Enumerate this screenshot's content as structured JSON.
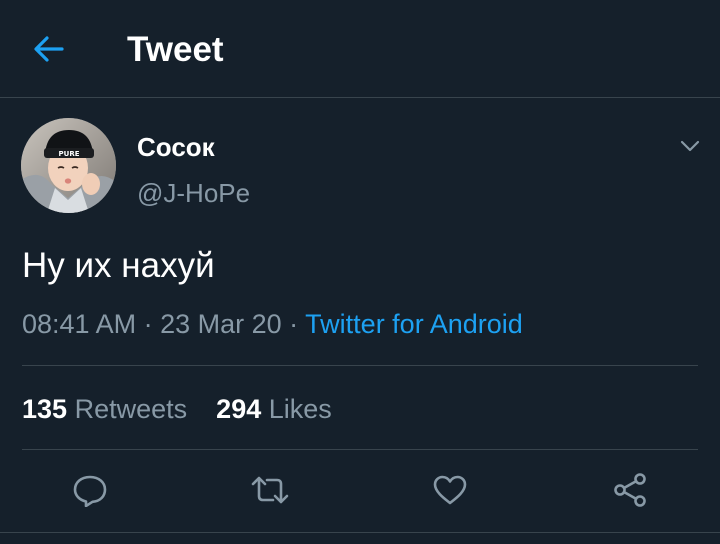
{
  "header": {
    "title": "Tweet",
    "back_icon": "arrow-left-icon"
  },
  "author": {
    "name": "Сосок",
    "handle": "@J-HoPe",
    "avatar_beanie_text": "PURE"
  },
  "tweet": {
    "text": "Ну их нахуй",
    "time": "08:41 AM",
    "date": "23 Mar 20",
    "separator": " · ",
    "source": "Twitter for Android"
  },
  "stats": {
    "retweets_count": "135",
    "retweets_label": "Retweets",
    "likes_count": "294",
    "likes_label": "Likes"
  },
  "actions": [
    {
      "icon": "reply-icon"
    },
    {
      "icon": "retweet-icon"
    },
    {
      "icon": "like-icon"
    },
    {
      "icon": "share-icon"
    }
  ],
  "colors": {
    "background": "#15202b",
    "accent": "#1da1f2",
    "secondary_text": "#8899a6",
    "divider": "#38444d"
  }
}
